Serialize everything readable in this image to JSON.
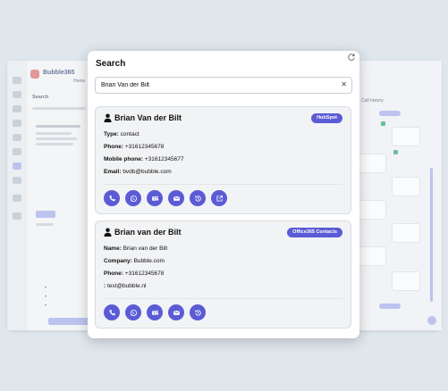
{
  "app": {
    "brand": "Bubble365",
    "bg_tab": "Home",
    "bg_section": "Search",
    "bg_right_title": "Call history"
  },
  "modal": {
    "title": "Search"
  },
  "search": {
    "value": "Brian Van der Bilt"
  },
  "results": [
    {
      "name": "Brian Van der Bilt",
      "source": "HubSpot",
      "fields": [
        {
          "label": "Type:",
          "value": " contact"
        },
        {
          "label": "Phone:",
          "value": " +31612345678"
        },
        {
          "label": "Mobile phone:",
          "value": " +31612345677"
        },
        {
          "label": "Email:",
          "value": " bvdb@bubble.com"
        }
      ],
      "actions": [
        "phone-icon",
        "whatsapp-icon",
        "teams-icon",
        "email-icon",
        "history-icon",
        "open-external-icon"
      ]
    },
    {
      "name": "Brian van der Bilt",
      "source": "Office365 Contacts",
      "fields": [
        {
          "label": "Name:",
          "value": " Brian van der Bilt"
        },
        {
          "label": "Company:",
          "value": " Bubble.com"
        },
        {
          "label": "Phone:",
          "value": " +31612345678"
        },
        {
          "label": ":",
          "value": " test@bubble.nl"
        }
      ],
      "actions": [
        "phone-icon",
        "whatsapp-icon",
        "teams-icon",
        "email-icon",
        "history-icon"
      ]
    }
  ],
  "colors": {
    "accent": "#5b5bd6",
    "card_bg": "#f2f3f5",
    "backdrop": "#dfe6ec"
  }
}
